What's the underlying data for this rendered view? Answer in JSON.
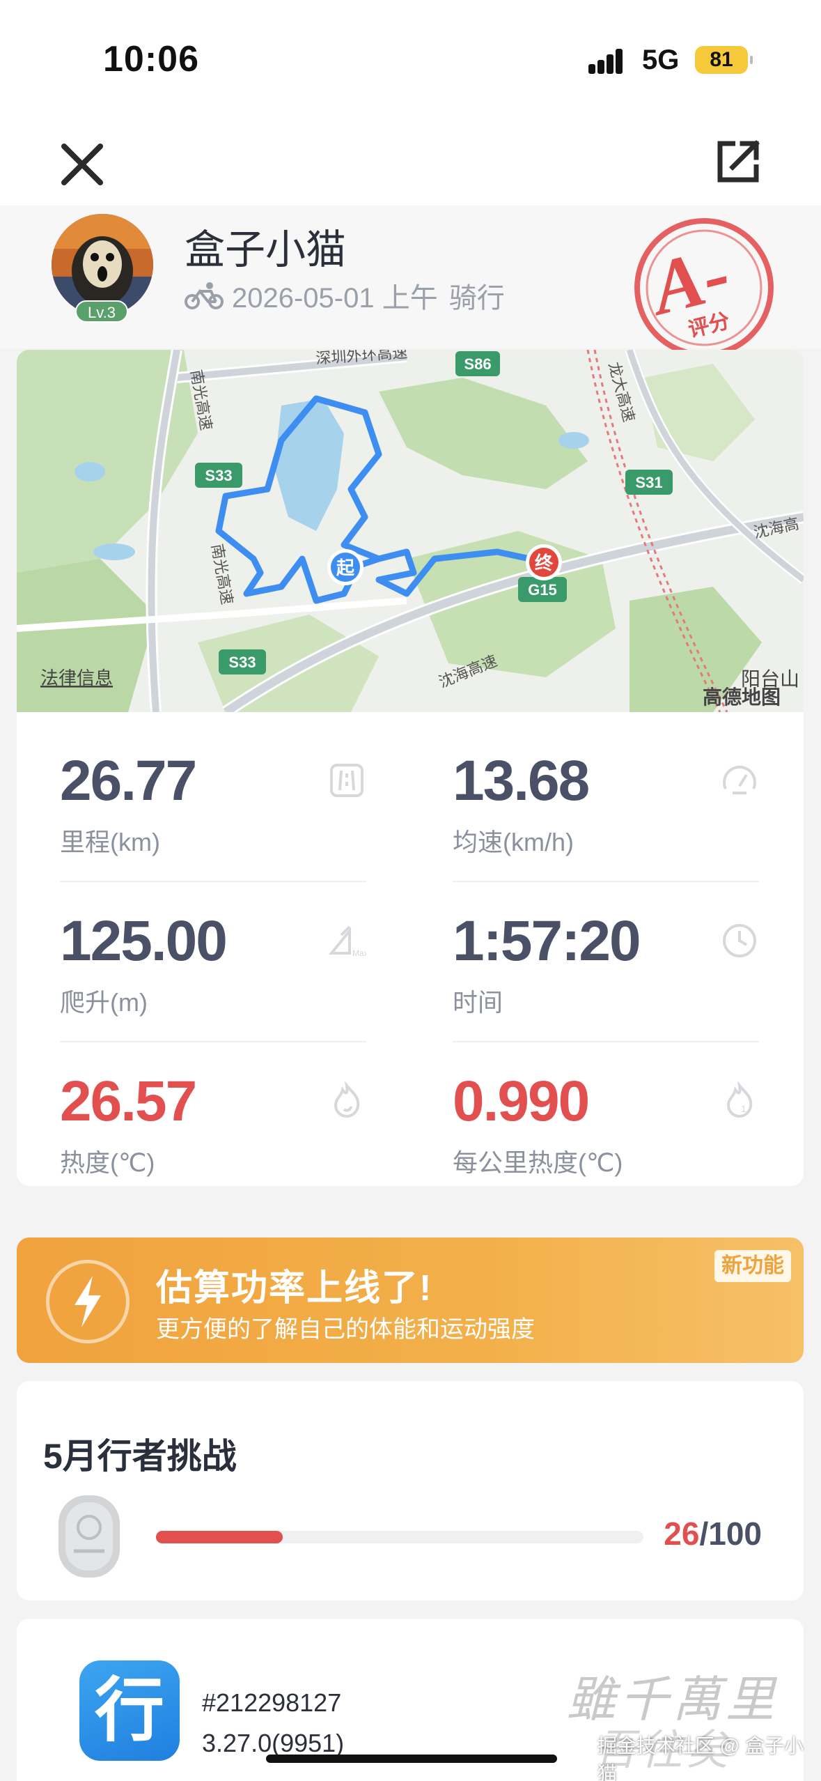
{
  "status_bar": {
    "time": "10:06",
    "network": "5G",
    "battery": "81",
    "battery_color": "#f5c93a"
  },
  "topbar": {
    "close_icon": "close-icon",
    "share_icon": "share-icon"
  },
  "profile": {
    "username": "盒子小猫",
    "level": "Lv.3",
    "date": "2026-05-01 上午",
    "activity": "骑行",
    "grade": "A-",
    "grade_label": "评分",
    "grade_color": "#e24f4f"
  },
  "map": {
    "legal_link": "法律信息",
    "provider": "高德地图",
    "start_label": "起",
    "end_label": "终",
    "place_yangtai": "阳台山",
    "roads": {
      "s86": "S86",
      "s33_top": "S33",
      "s33_bottom": "S33",
      "s31": "S31",
      "g15": "G15",
      "shenzhen_outer": "深圳外环高速",
      "nanguang_top": "南光高速",
      "nanguang_bottom": "南光高速",
      "longda": "龙大高速",
      "shenhai_bottom": "沈海高速",
      "shenhai_right": "沈海高"
    },
    "route_color": "#3d8ef0"
  },
  "stats": {
    "distance": {
      "value": "26.77",
      "label": "里程(km)"
    },
    "avg_speed": {
      "value": "13.68",
      "label": "均速(km/h)"
    },
    "climb": {
      "value": "125.00",
      "label": "爬升(m)"
    },
    "time": {
      "value": "1:57:20",
      "label": "时间"
    },
    "calories": {
      "value": "26.57",
      "label": "热度(℃)"
    },
    "cal_per_km": {
      "value": "0.990",
      "label": "每公里热度(℃)"
    }
  },
  "banner": {
    "title": "估算功率上线了!",
    "subtitle": "更方便的了解自己的体能和运动强度",
    "badge": "新功能"
  },
  "challenge": {
    "title": "5月行者挑战",
    "current": "26",
    "total": "100",
    "separator": "/",
    "progress": 0.26
  },
  "footer": {
    "app_icon_text": "行",
    "record_id": "#212298127",
    "version": "3.27.0(9951)",
    "calligraphy_line1": "雖千萬里",
    "calligraphy_line2": "吾往矣",
    "watermark": "掘金技术社区 @ 盒子小猫"
  }
}
